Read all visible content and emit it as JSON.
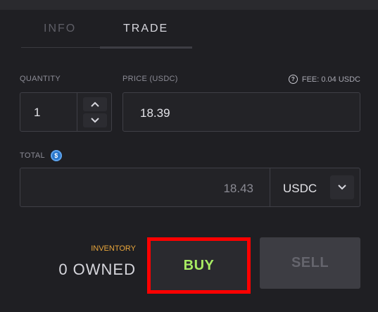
{
  "tabs": [
    {
      "label": "INFO"
    },
    {
      "label": "TRADE"
    }
  ],
  "quantity": {
    "label": "QUANTITY",
    "value": "1"
  },
  "price": {
    "label": "PRICE (USDC)",
    "value": "18.39"
  },
  "fee": {
    "icon": "help-icon",
    "text": "FEE: 0.04 USDC"
  },
  "total": {
    "label": "TOTAL",
    "icon": "usdc-icon",
    "value": "18.43",
    "currency": "USDC"
  },
  "inventory": {
    "label": "INVENTORY",
    "owned": "0 OWNED"
  },
  "actions": {
    "buy_label": "BUY",
    "sell_label": "SELL"
  },
  "colors": {
    "buy_text": "#a8ec63",
    "highlight": "#ff0000",
    "inventory_label": "#e8a53b",
    "usdc": "#2775ca"
  }
}
